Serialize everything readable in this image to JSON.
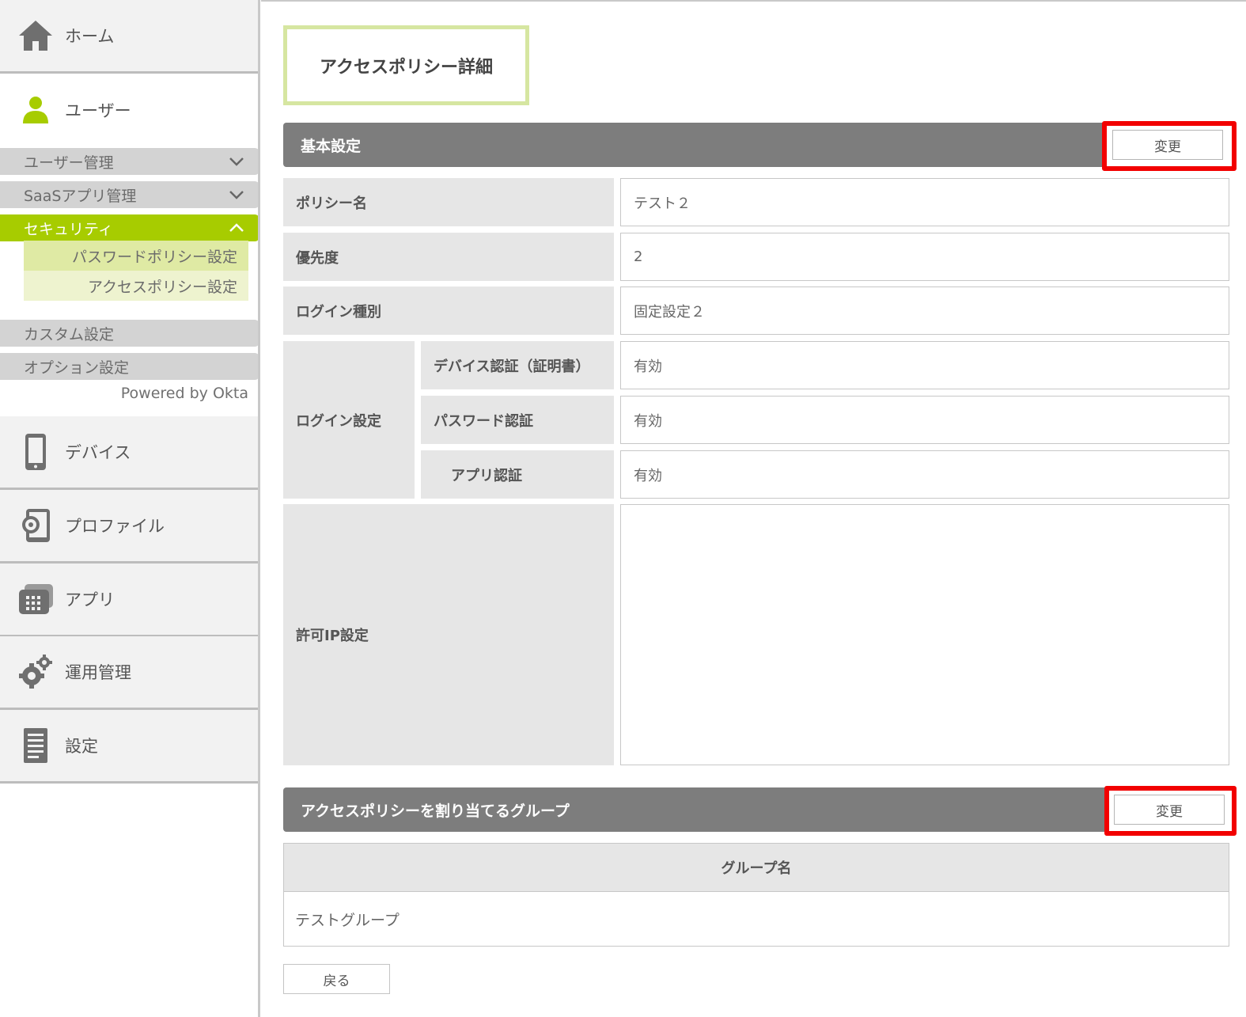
{
  "colors": {
    "accent_green": "#a7cc00",
    "highlight_red": "#f20000",
    "section_gray": "#7d7d7d",
    "label_cell": "#e6e6e6"
  },
  "sidebar": {
    "home": {
      "label": "ホーム",
      "icon": "home-icon"
    },
    "user": {
      "label": "ユーザー",
      "icon": "user-icon"
    },
    "submenu": [
      {
        "label": "ユーザー管理",
        "state": "collapsed"
      },
      {
        "label": "SaaSアプリ管理",
        "state": "collapsed"
      },
      {
        "label": "セキュリティ",
        "state": "expanded"
      }
    ],
    "security_items": [
      {
        "label": "パスワードポリシー設定"
      },
      {
        "label": "アクセスポリシー設定"
      }
    ],
    "extra": [
      {
        "label": "カスタム設定"
      },
      {
        "label": "オプション設定"
      }
    ],
    "powered": "Powered by Okta",
    "nav": [
      {
        "label": "デバイス",
        "icon": "smartphone-icon"
      },
      {
        "label": "プロファイル",
        "icon": "profile-gear-icon"
      },
      {
        "label": "アプリ",
        "icon": "apps-icon"
      },
      {
        "label": "運用管理",
        "icon": "gears-icon"
      },
      {
        "label": "設定",
        "icon": "document-icon"
      }
    ]
  },
  "main": {
    "page_title": "アクセスポリシー詳細",
    "basic": {
      "header": "基本設定",
      "change_label": "変更",
      "policy_name": {
        "label": "ポリシー名",
        "value": "テスト２"
      },
      "priority": {
        "label": "優先度",
        "value": "2"
      },
      "login_type": {
        "label": "ログイン種別",
        "value": "固定設定２"
      },
      "login_settings": {
        "label": "ログイン設定",
        "rows": [
          {
            "label": "デバイス認証（証明書）",
            "value": "有効"
          },
          {
            "label": "パスワード認証",
            "value": "有効"
          },
          {
            "label": "アプリ認証",
            "value": "有効"
          }
        ]
      },
      "allowed_ip": {
        "label": "許可IP設定",
        "value": ""
      }
    },
    "groups": {
      "header": "アクセスポリシーを割り当てるグループ",
      "change_label": "変更",
      "column": "グループ名",
      "rows": [
        "テストグループ"
      ]
    },
    "back_label": "戻る"
  }
}
